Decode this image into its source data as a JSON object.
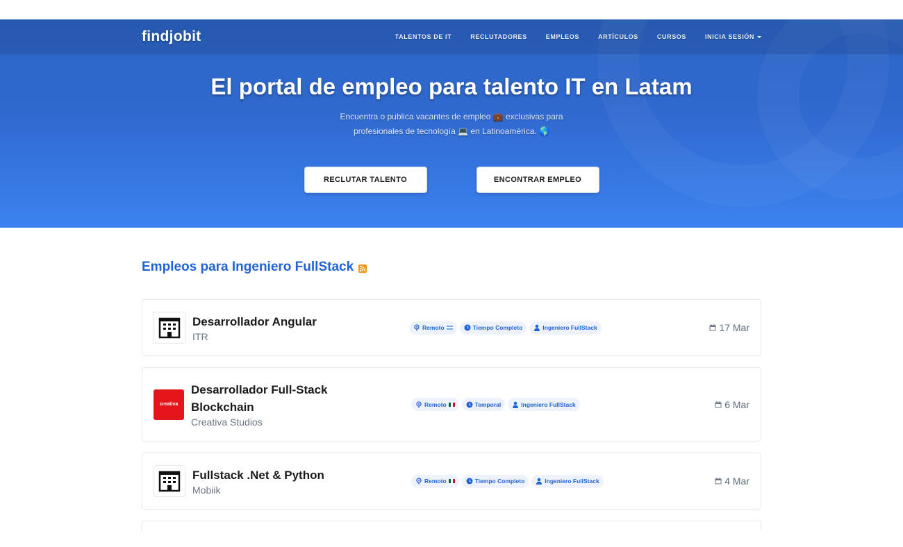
{
  "nav": {
    "logo": "findjobit",
    "links": [
      "TALENTOS DE IT",
      "RECLUTADORES",
      "EMPLEOS",
      "ARTÍCULOS",
      "CURSOS",
      "INICIA SESIÓN"
    ]
  },
  "hero": {
    "title": "El portal de empleo para talento IT en Latam",
    "subtitle_line1": "Encuentra o publica vacantes de empleo 💼 exclusivas para",
    "subtitle_line2": "profesionales de tecnología 💻 en Latinoamérica. 🌎",
    "btn_recruit": "RECLUTAR TALENTO",
    "btn_find": "ENCONTRAR EMPLEO"
  },
  "section": {
    "title": "Empleos para Ingeniero FullStack"
  },
  "jobs": [
    {
      "title": "Desarrollador Angular",
      "company": "ITR",
      "location": "Remoto",
      "flag": "argentina",
      "type": "Tiempo Completo",
      "role": "Ingeniero FullStack",
      "date": "17 Mar",
      "logo": "building"
    },
    {
      "title": "Desarrollador Full-Stack Blockchain",
      "company": "Creativa Studios",
      "location": "Remoto",
      "flag": "mexico",
      "type": "Temporal",
      "role": "Ingeniero FullStack",
      "date": "6 Mar",
      "logo": "creativa",
      "logo_text": "creativa"
    },
    {
      "title": "Fullstack .Net & Python",
      "company": "Mobiik",
      "location": "Remoto",
      "flag": "mexico",
      "type": "Tiempo Completo",
      "role": "Ingeniero FullStack",
      "date": "4 Mar",
      "logo": "building"
    }
  ],
  "colors": {
    "accent": "#1f63d6",
    "hero_top": "#2a66c4",
    "hero_bottom": "#3b82f0",
    "rss": "#f7941d",
    "creativa_red": "#e3161b"
  }
}
